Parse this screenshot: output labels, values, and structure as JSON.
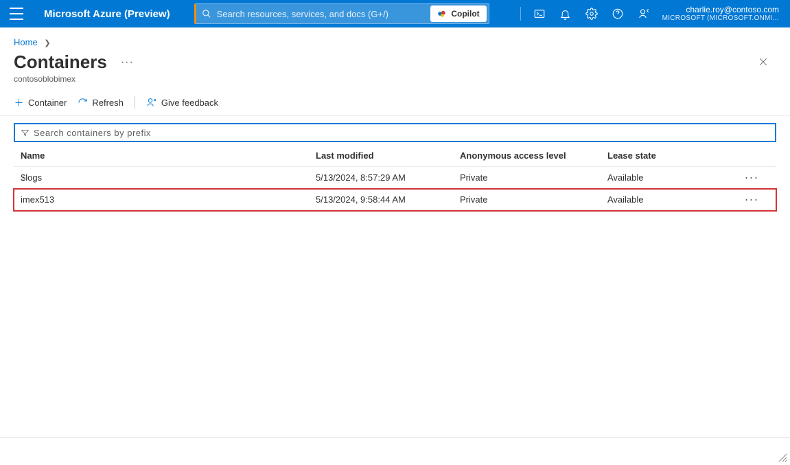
{
  "header": {
    "brand": "Microsoft Azure (Preview)",
    "search_placeholder": "Search resources, services, and docs (G+/)",
    "copilot_label": "Copilot",
    "user_email": "charlie.roy@contoso.com",
    "user_org": "MICROSOFT (MICROSOFT.ONMI..."
  },
  "breadcrumb": {
    "home": "Home"
  },
  "page": {
    "title": "Containers",
    "subtitle": "contosoblobimex"
  },
  "toolbar": {
    "container_label": "Container",
    "refresh_label": "Refresh",
    "feedback_label": "Give feedback"
  },
  "filter": {
    "placeholder": "Search containers by prefix"
  },
  "table": {
    "headers": {
      "name": "Name",
      "last_modified": "Last modified",
      "access": "Anonymous access level",
      "lease": "Lease state"
    },
    "rows": [
      {
        "name": "$logs",
        "last_modified": "5/13/2024, 8:57:29 AM",
        "access": "Private",
        "lease": "Available",
        "highlight": false
      },
      {
        "name": "imex513",
        "last_modified": "5/13/2024, 9:58:44 AM",
        "access": "Private",
        "lease": "Available",
        "highlight": true
      }
    ]
  }
}
